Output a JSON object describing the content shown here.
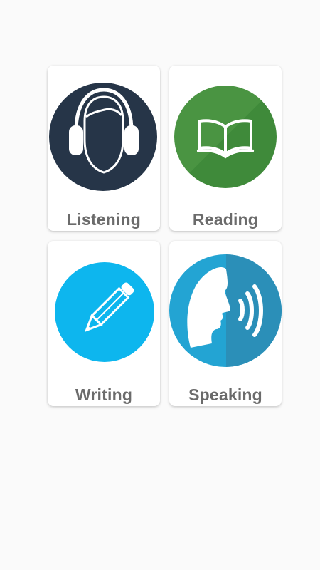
{
  "modules": [
    {
      "label": "Listening",
      "icon": "headphones-head-icon",
      "color": "#263548"
    },
    {
      "label": "Reading",
      "icon": "open-book-icon",
      "color": "#4a9442"
    },
    {
      "label": "Writing",
      "icon": "pencil-icon",
      "color": "#0db6ee"
    },
    {
      "label": "Speaking",
      "icon": "speaking-head-icon",
      "color": "#23a4d3"
    }
  ],
  "colors": {
    "background": "#fafafa",
    "card": "#ffffff",
    "label": "#6b6b6b"
  }
}
